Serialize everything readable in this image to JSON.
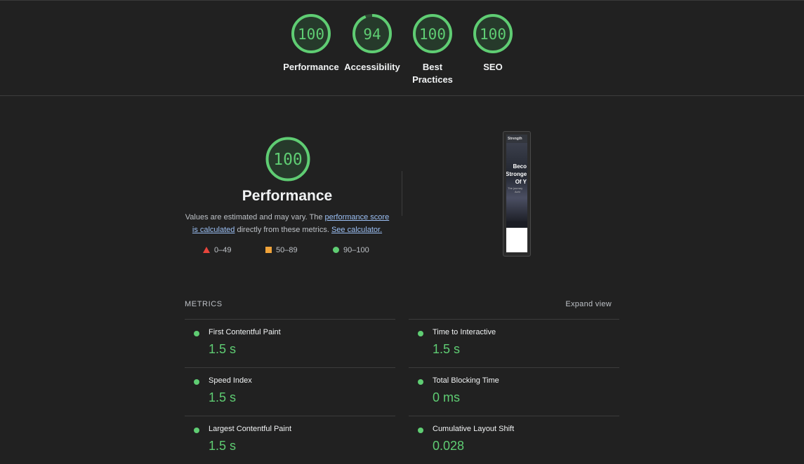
{
  "categories": [
    {
      "label": "Performance",
      "score": 100
    },
    {
      "label": "Accessibility",
      "score": 94
    },
    {
      "label": "Best Practices",
      "score": 100
    },
    {
      "label": "SEO",
      "score": 100
    }
  ],
  "performance": {
    "score": 100,
    "title": "Performance",
    "desc_prefix": "Values are estimated and may vary. The ",
    "desc_link1": "performance score is calculated",
    "desc_middle": " directly from these metrics. ",
    "desc_link2": "See calculator."
  },
  "legend": [
    {
      "range": "0–49",
      "shape": "triangle",
      "color": "#e8453c"
    },
    {
      "range": "50–89",
      "shape": "square",
      "color": "#f0a33a"
    },
    {
      "range": "90–100",
      "shape": "circle",
      "color": "#5fcd73"
    }
  ],
  "thumbnail": {
    "nav_text": "Strength",
    "headline": [
      "Beco",
      "Stronge",
      "Of Y"
    ],
    "sub": [
      "The journey",
      "Achi"
    ]
  },
  "metrics": {
    "title": "METRICS",
    "expand_label": "Expand view",
    "items": [
      {
        "name": "First Contentful Paint",
        "value": "1.5 s"
      },
      {
        "name": "Time to Interactive",
        "value": "1.5 s"
      },
      {
        "name": "Speed Index",
        "value": "1.5 s"
      },
      {
        "name": "Total Blocking Time",
        "value": "0 ms"
      },
      {
        "name": "Largest Contentful Paint",
        "value": "1.5 s"
      },
      {
        "name": "Cumulative Layout Shift",
        "value": "0.028"
      }
    ]
  },
  "colors": {
    "pass": "#5fcd73",
    "average": "#f0a33a",
    "fail": "#e8453c",
    "background": "#212121"
  }
}
